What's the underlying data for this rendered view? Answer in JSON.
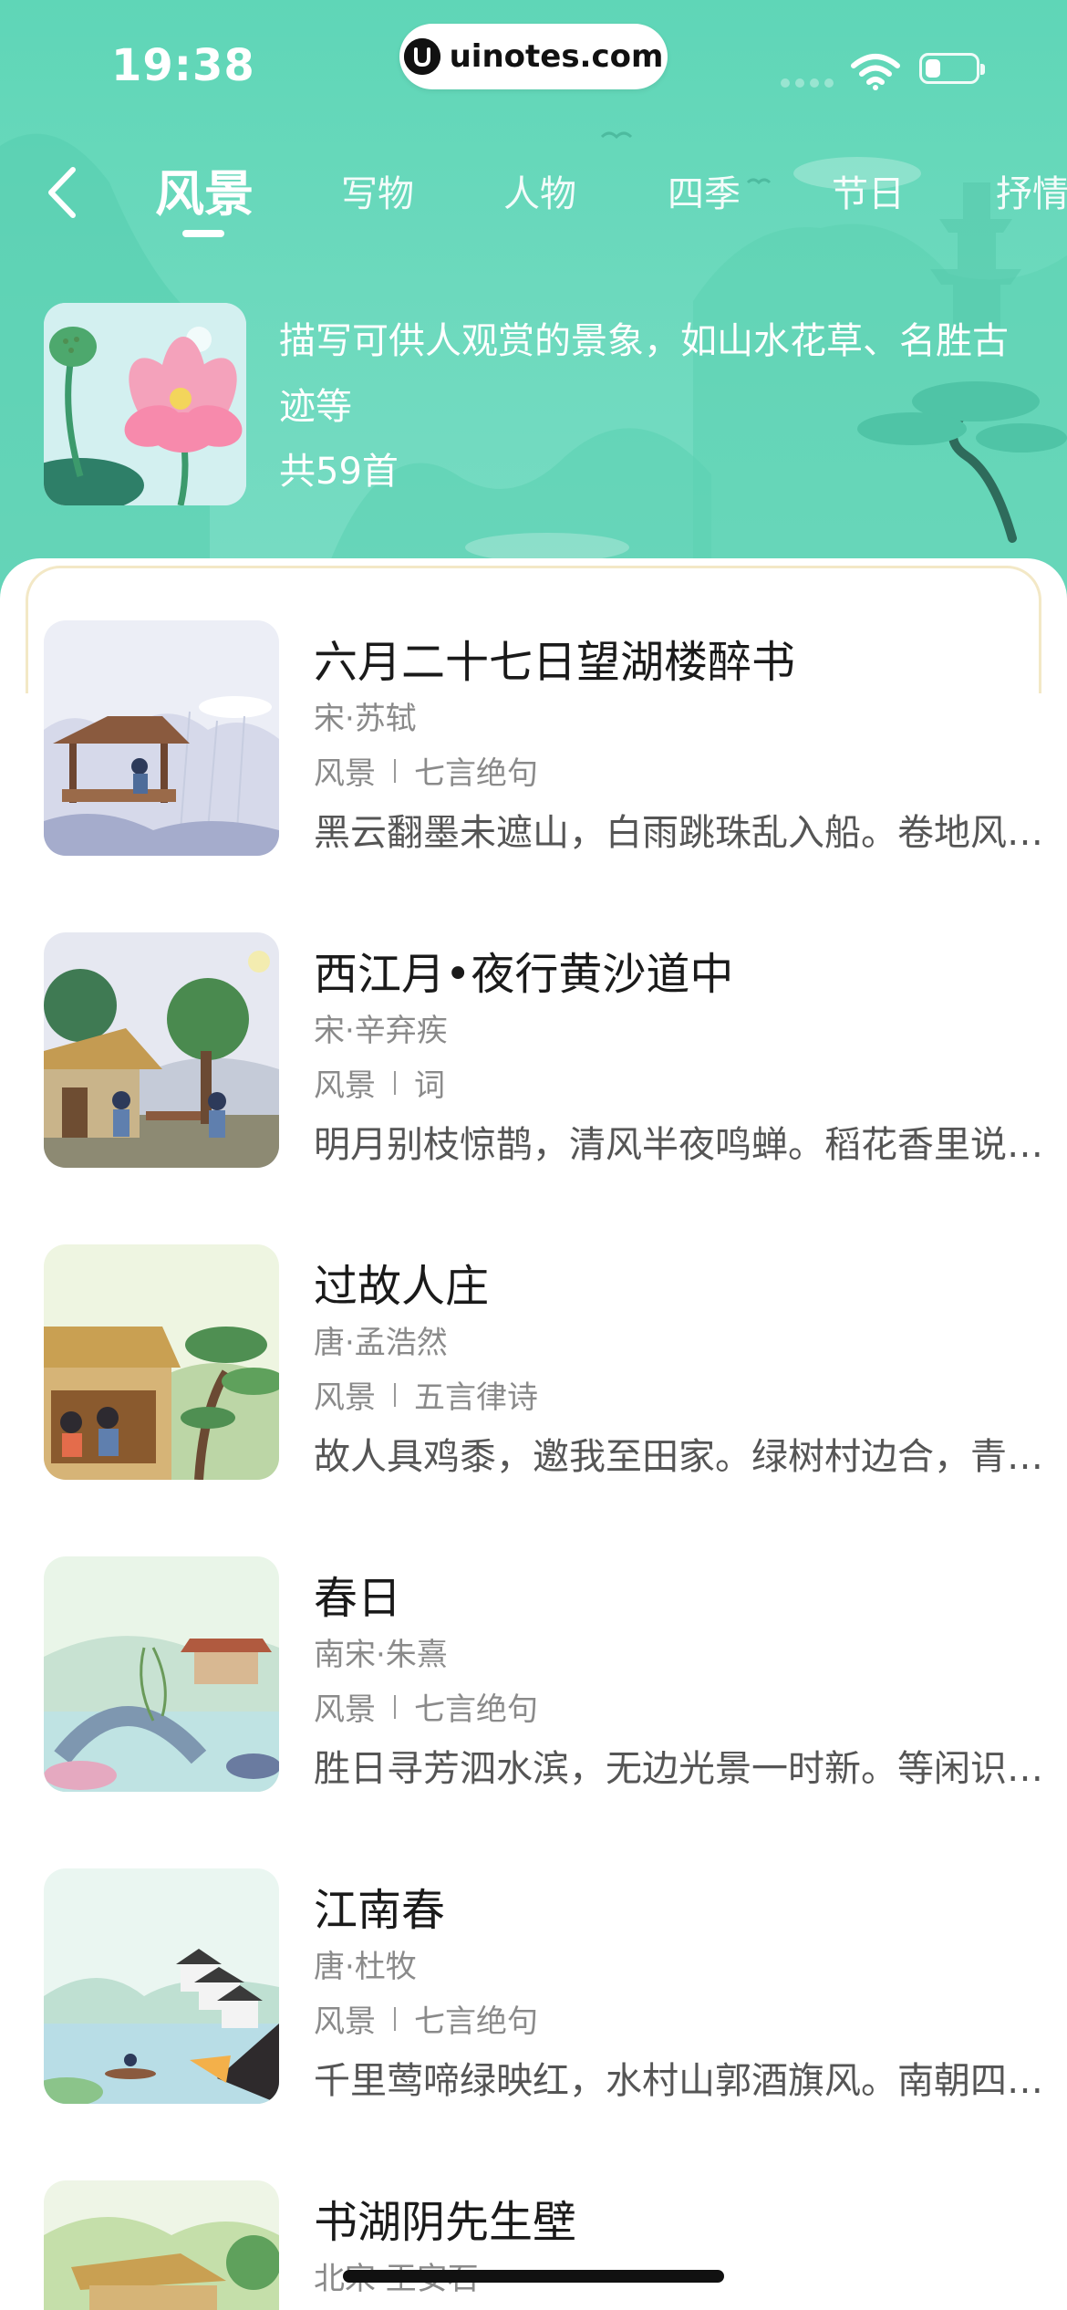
{
  "status_bar": {
    "time": "19:38",
    "url": "uinotes.com",
    "battery_level": 0.3
  },
  "nav": {
    "back_icon": "chevron-left-icon",
    "tabs": [
      {
        "label": "风景",
        "active": true
      },
      {
        "label": "写物",
        "active": false
      },
      {
        "label": "人物",
        "active": false
      },
      {
        "label": "四季",
        "active": false
      },
      {
        "label": "节日",
        "active": false
      },
      {
        "label": "抒情",
        "active": false
      }
    ]
  },
  "intro": {
    "description": "描写可供人观赏的景象，如山水花草、名胜古迹等",
    "count": "共59首"
  },
  "poems": [
    {
      "title": "六月二十七日望湖楼醉书",
      "author": "宋·苏轼",
      "category": "风景",
      "form": "七言绝句",
      "excerpt": "黑云翻墨未遮山，白雨跳珠乱入船。卷地风来忽吹散，望湖楼下水如天。"
    },
    {
      "title": "西江月•夜行黄沙道中",
      "author": "宋·辛弃疾",
      "category": "风景",
      "form": "词",
      "excerpt": "明月别枝惊鹊，清风半夜鸣蝉。稻花香里说丰年，听取蛙声一片。"
    },
    {
      "title": "过故人庄",
      "author": "唐·孟浩然",
      "category": "风景",
      "form": "五言律诗",
      "excerpt": "故人具鸡黍，邀我至田家。绿树村边合，青山郭外斜。"
    },
    {
      "title": "春日",
      "author": "南宋·朱熹",
      "category": "风景",
      "form": "七言绝句",
      "excerpt": "胜日寻芳泗水滨，无边光景一时新。等闲识得东风面，万紫千红总是春。"
    },
    {
      "title": "江南春",
      "author": "唐·杜牧",
      "category": "风景",
      "form": "七言绝句",
      "excerpt": "千里莺啼绿映红，水村山郭酒旗风。南朝四百八十寺，多少楼台烟雨中。"
    },
    {
      "title": "书湖阴先生壁",
      "author": "北宋·王安石",
      "category": "",
      "form": "",
      "excerpt": ""
    }
  ],
  "colors": {
    "header_green": "#6cd9bd",
    "card_border": "#f3e8c6"
  }
}
